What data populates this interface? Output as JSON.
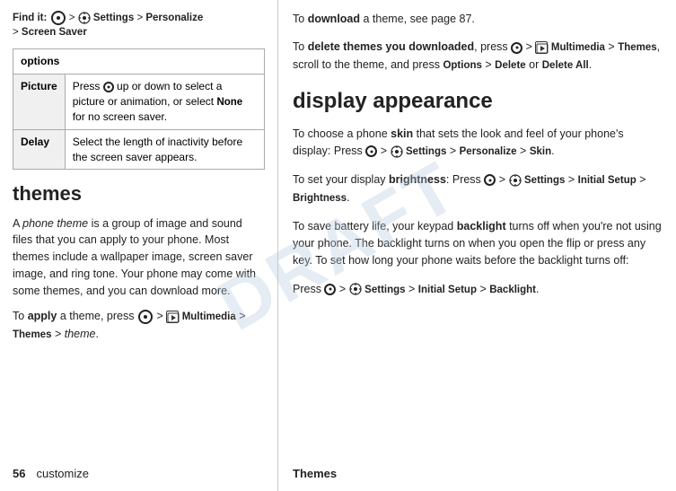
{
  "left": {
    "find_it_label": "Find it:",
    "find_it_path": " > ",
    "find_it_settings": "Settings",
    "find_it_personalize": "Personalize",
    "find_it_screen_saver": "Screen Saver",
    "options_header": "options",
    "table_rows": [
      {
        "label": "Picture",
        "description": "Press up or down to select a picture or animation, or select None for no screen saver."
      },
      {
        "label": "Delay",
        "description": "Select the length of inactivity before the screen saver appears."
      }
    ],
    "section_title": "themes",
    "body_text_1": "A phone theme is a group of image and sound files that you can apply to your phone. Most themes include a wallpaper image, screen saver image, and ring tone. Your phone may come with some themes, and you can download more.",
    "apply_prefix": "To ",
    "apply_bold": "apply",
    "apply_text": " a theme, press ",
    "apply_multimedia": "Multimedia",
    "apply_themes": "Themes",
    "apply_theme_var": "theme",
    "page_number": "56",
    "page_label": "customize",
    "themes_footer": "Themes"
  },
  "right": {
    "download_prefix": "To ",
    "download_bold": "download",
    "download_text": " a theme, see page 87.",
    "delete_prefix": "To ",
    "delete_bold": "delete themes you downloaded",
    "delete_text_1": ", press",
    "delete_multimedia": "Multimedia",
    "delete_themes": "Themes",
    "delete_scroll": ", scroll to the theme, and press ",
    "delete_options": "Options",
    "delete_or": " > ",
    "delete_delete": "Delete",
    "delete_or2": " or ",
    "delete_all": "Delete All",
    "delete_end": ".",
    "section_heading": "display appearance",
    "skin_prefix": "To choose a phone ",
    "skin_bold": "skin",
    "skin_text": " that sets the look and feel of your phone's display: Press",
    "skin_path": " > Settings > Personalize > Skin",
    "brightness_prefix": "To set your display ",
    "brightness_bold": "brightness",
    "brightness_text": ": Press",
    "brightness_path": " > Settings > Initial Setup > Brightness",
    "backlight_para": "To save battery life, your keypad backlight turns off when you’re not using your phone. The backlight turns on when you open the flip or press any key. To set how long your phone waits before the backlight turns off:",
    "backlight_bold": "backlight",
    "backlight_press": "Press ",
    "backlight_path": " > Settings > Initial Setup > Backlight."
  }
}
